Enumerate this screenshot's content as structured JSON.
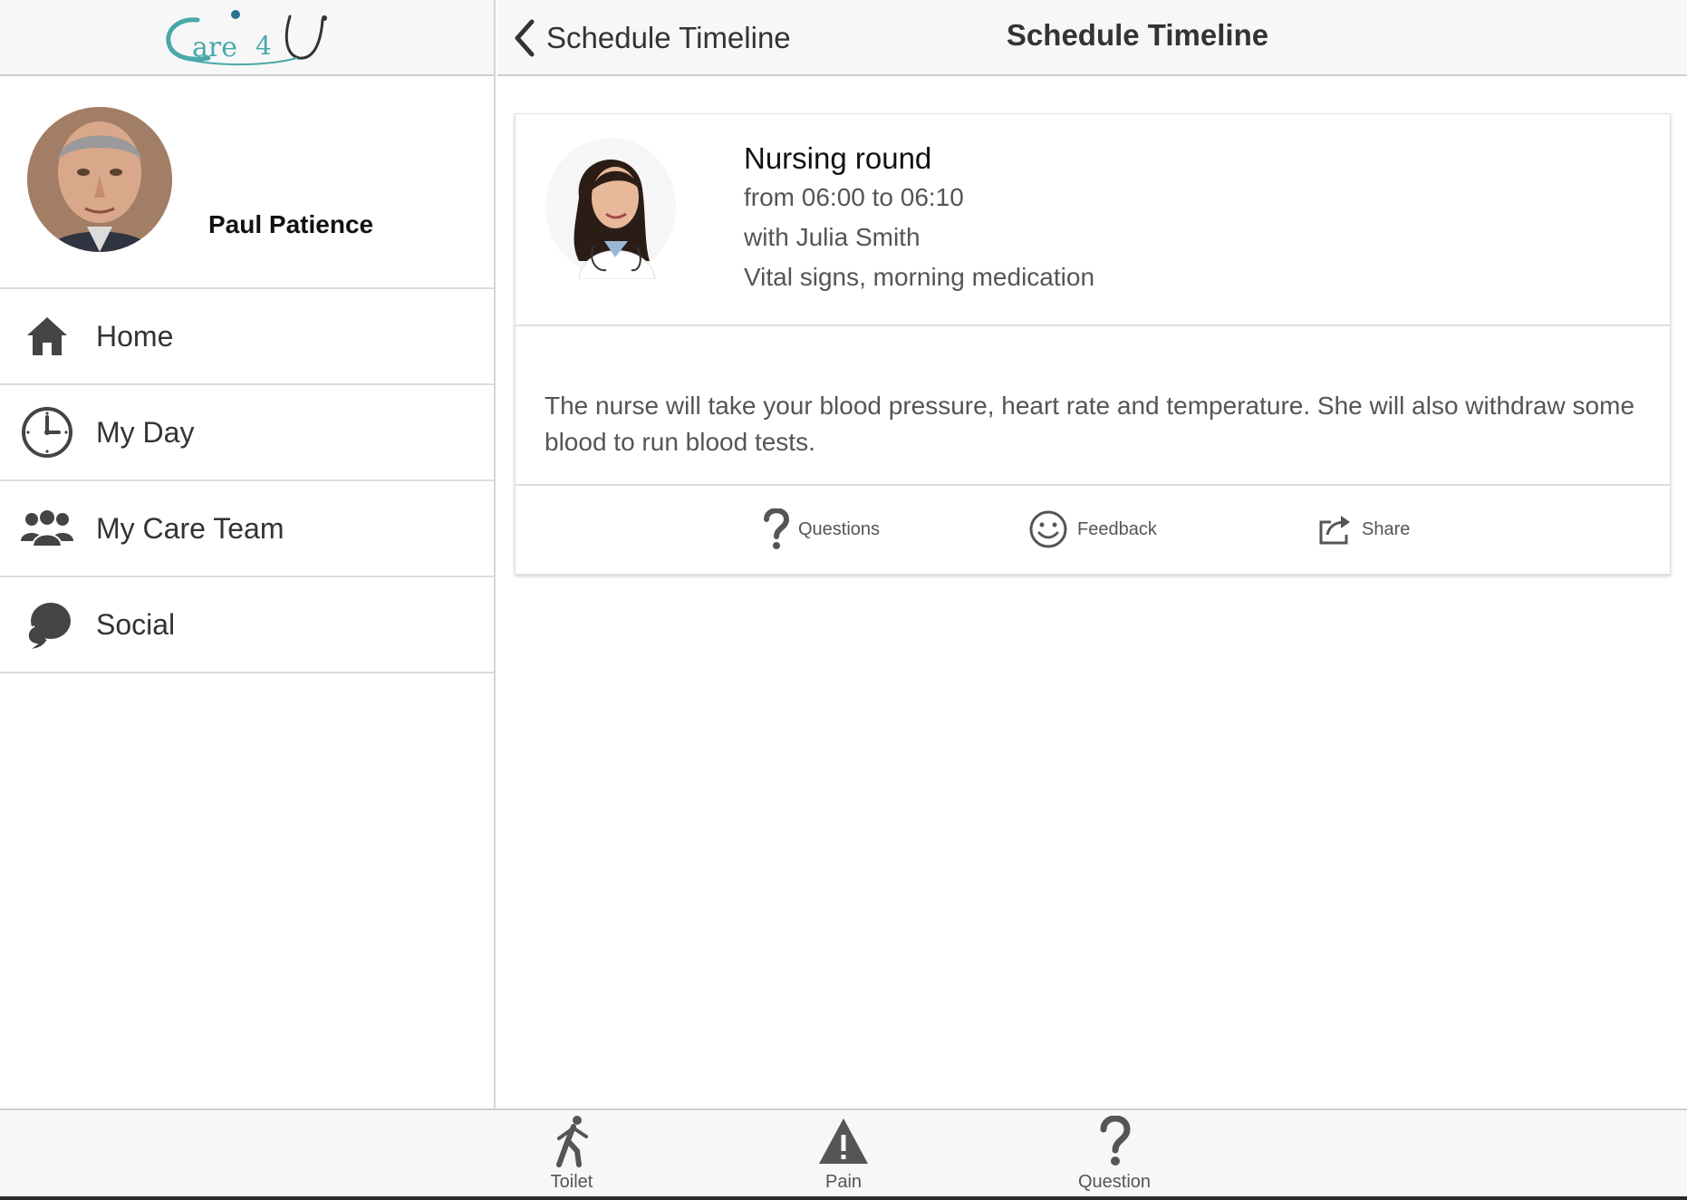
{
  "app": {
    "logo_text": "Care4U",
    "accent_color": "#4aa8a8"
  },
  "profile": {
    "name": "Paul Patience"
  },
  "sidebar": {
    "items": [
      {
        "label": "Home",
        "icon": "home-icon"
      },
      {
        "label": "My Day",
        "icon": "clock-icon"
      },
      {
        "label": "My Care Team",
        "icon": "team-icon"
      },
      {
        "label": "Social",
        "icon": "chat-icon"
      }
    ]
  },
  "header": {
    "back_label": "Schedule Timeline",
    "title": "Schedule Timeline"
  },
  "card": {
    "title": "Nursing round",
    "time": "from 06:00 to 06:10",
    "with": "with Julia Smith",
    "summary": "Vital signs, morning medication",
    "description": "The nurse will take your blood pressure, heart rate and temperature. She will also withdraw some blood to run blood tests.",
    "actions": [
      {
        "label": "Questions",
        "icon": "question-icon"
      },
      {
        "label": "Feedback",
        "icon": "smiley-icon"
      },
      {
        "label": "Share",
        "icon": "share-icon"
      }
    ]
  },
  "bottom_tabs": [
    {
      "label": "Toilet",
      "icon": "walking-person-icon"
    },
    {
      "label": "Pain",
      "icon": "warning-icon"
    },
    {
      "label": "Question",
      "icon": "question-icon"
    }
  ]
}
